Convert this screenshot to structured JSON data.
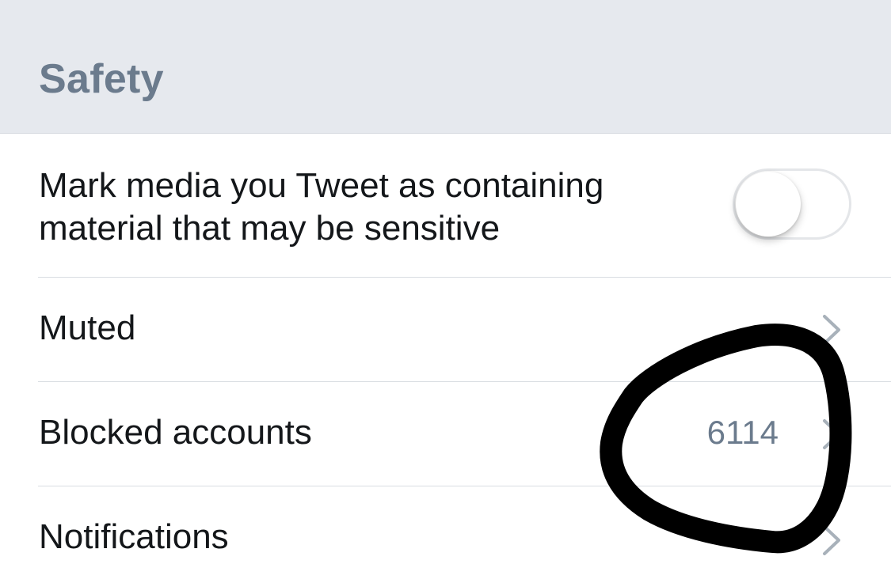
{
  "section": {
    "title": "Safety"
  },
  "rows": [
    {
      "line1": "Mark media you Tweet as containing",
      "line2": "material that may be sensitive",
      "toggle_on": false
    },
    {
      "label": "Muted"
    },
    {
      "label": "Blocked accounts",
      "value": "6114"
    },
    {
      "label": "Notifications"
    }
  ],
  "icons": {
    "chevron": "chevron-right-icon",
    "annotation": "hand-drawn-circle"
  },
  "colors": {
    "header_bg": "#e6e9ee",
    "header_text": "#6b7b8d",
    "label_text": "#14171a",
    "value_text": "#6b7b8d",
    "chevron": "#a8b1ba",
    "annotation": "#000000"
  }
}
